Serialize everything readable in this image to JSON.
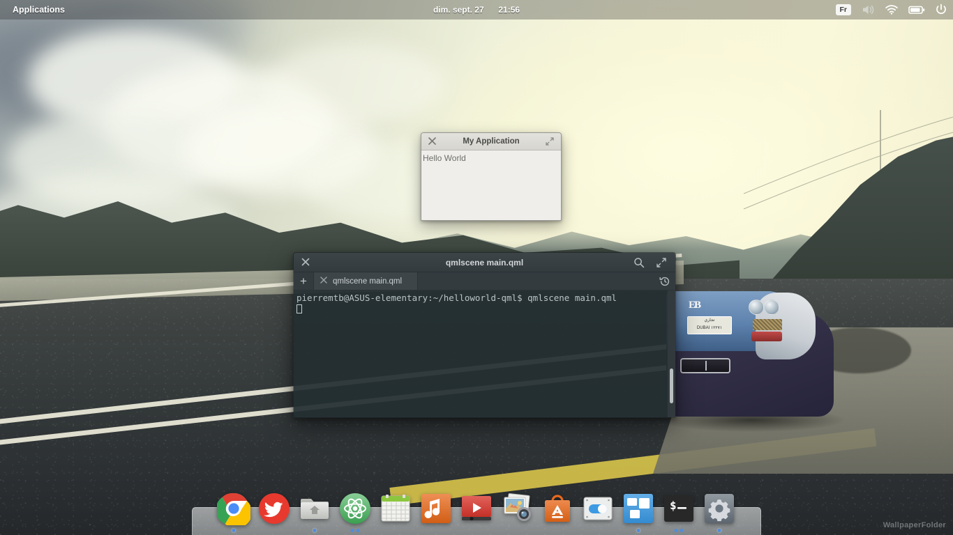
{
  "panel": {
    "applications_label": "Applications",
    "date": "dim. sept. 27",
    "time": "21:56",
    "keyboard_layout": "Fr",
    "tray": [
      {
        "name": "keyboard-layout-indicator",
        "label": "Fr"
      },
      {
        "name": "volume-icon",
        "label": "volume-icon"
      },
      {
        "name": "wifi-icon",
        "label": "wifi-icon"
      },
      {
        "name": "battery-icon",
        "label": "battery-icon"
      },
      {
        "name": "power-icon",
        "label": "power-icon"
      }
    ]
  },
  "qml_window": {
    "title": "My Application",
    "content": "Hello World",
    "close_glyph": "×",
    "maximize_glyph": "⤡"
  },
  "terminal": {
    "title": "qmlscene main.qml",
    "tab_label": "qmlscene main.qml",
    "new_tab_glyph": "+",
    "tab_close_glyph": "×",
    "close_glyph": "×",
    "prompt": "pierremtb@ASUS-elementary:~/helloworld-qml$",
    "command": "qmlscene main.qml",
    "line1": "pierremtb@ASUS-elementary:~/helloworld-qml$ qmlscene main.qml",
    "icons": {
      "search": "search-icon",
      "maximize": "maximize-icon",
      "history": "history-icon"
    }
  },
  "dock": {
    "items": [
      {
        "name": "google-chrome",
        "label": "Google Chrome",
        "running": true,
        "indicators": 1
      },
      {
        "name": "twitter",
        "label": "Twitter",
        "running": false,
        "indicators": 0
      },
      {
        "name": "files",
        "label": "Files",
        "running": true,
        "indicators": 1
      },
      {
        "name": "atom",
        "label": "Atom",
        "running": true,
        "indicators": 2
      },
      {
        "name": "calendar",
        "label": "Calendar",
        "running": false,
        "indicators": 0
      },
      {
        "name": "music",
        "label": "Music",
        "running": false,
        "indicators": 0
      },
      {
        "name": "videos",
        "label": "Videos",
        "running": false,
        "indicators": 0
      },
      {
        "name": "photos",
        "label": "Photos",
        "running": false,
        "indicators": 0
      },
      {
        "name": "appcenter",
        "label": "AppCenter",
        "running": false,
        "indicators": 0
      },
      {
        "name": "switchboard",
        "label": "System Settings",
        "running": false,
        "indicators": 0
      },
      {
        "name": "window-tiles",
        "label": "Workspaces",
        "running": true,
        "indicators": 1
      },
      {
        "name": "terminal",
        "label": "Terminal",
        "running": true,
        "indicators": 2
      },
      {
        "name": "settings-gear",
        "label": "Settings",
        "running": true,
        "indicators": 1
      }
    ]
  },
  "wallpaper": {
    "watermark": "WallpaperFolder",
    "car_badge": "EB",
    "car_plate_top": "تجاري",
    "car_plate_bottom": "DUBAI  ١٢٢٧١"
  },
  "colors": {
    "panel_bg": "#2a2c2b",
    "terminal_titlebar": "#3c4448",
    "terminal_screen": "#232e32",
    "terminal_text": "#b9c4c6",
    "qml_window_bg": "#efeeea",
    "dock_bg": "#eceeee",
    "indicator": "#508cdc"
  }
}
